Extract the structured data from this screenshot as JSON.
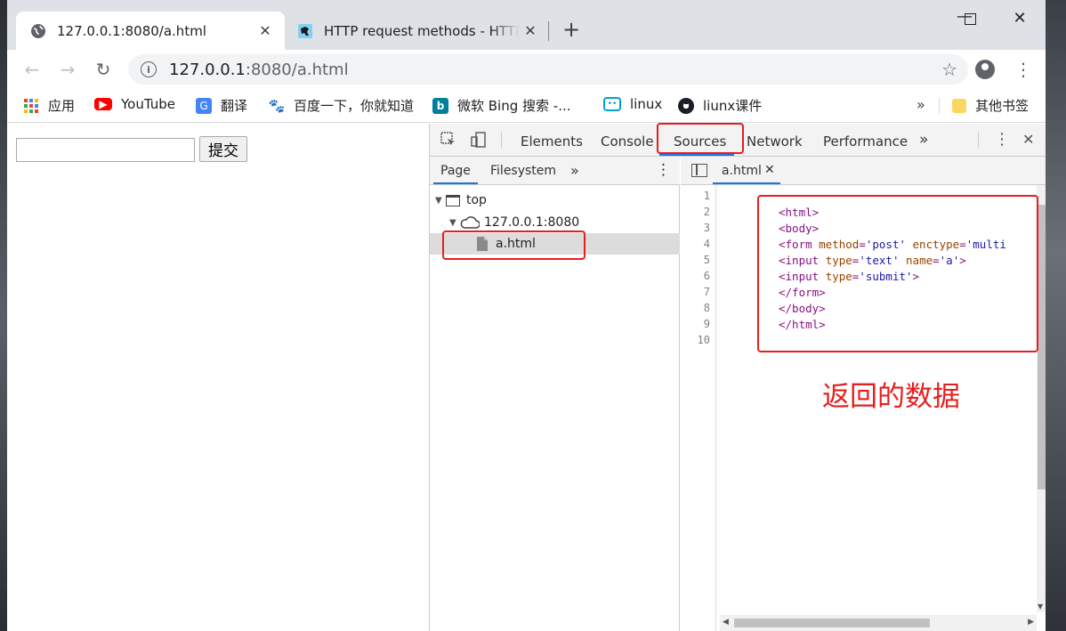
{
  "tabs": [
    {
      "title": "127.0.0.1:8080/a.html",
      "icon": "globe-icon"
    },
    {
      "title": "HTTP request methods - HTTP",
      "icon": "mdn-dino-icon"
    }
  ],
  "omnibox": {
    "host": "127.0.0.1",
    "rest": ":8080/a.html"
  },
  "bookmarks": [
    {
      "label": "应用",
      "icon": "apps-grid-icon"
    },
    {
      "label": "YouTube",
      "icon": "youtube-icon"
    },
    {
      "label": "翻译",
      "icon": "translate-icon"
    },
    {
      "label": "百度一下，你就知道",
      "icon": "baidu-paw-icon"
    },
    {
      "label": "微软 Bing 搜索 -...",
      "icon": "bing-icon"
    },
    {
      "label": "linux",
      "icon": "bilibili-tv-icon"
    },
    {
      "label": "liunx课件",
      "icon": "github-icon"
    }
  ],
  "bookmarks_more": "»",
  "bookmarks_other": "其他书签",
  "page": {
    "submit_label": "提交",
    "input_value": ""
  },
  "devtools": {
    "tabs": [
      "Elements",
      "Console",
      "Sources",
      "Network",
      "Performance"
    ],
    "more": "»",
    "nav_tabs": [
      "Page",
      "Filesystem"
    ],
    "tree": {
      "top": "top",
      "origin": "127.0.0.1:8080",
      "file": "a.html"
    },
    "editor_file": "a.html",
    "line_numbers": [
      "1",
      "2",
      "3",
      "4",
      "5",
      "6",
      "7",
      "8",
      "9",
      "10"
    ]
  },
  "code_lines": [
    {
      "parts": []
    },
    {
      "parts": [
        {
          "c": "tag",
          "t": "<html>"
        }
      ]
    },
    {
      "parts": [
        {
          "c": "tag",
          "t": "<body>"
        }
      ]
    },
    {
      "parts": [
        {
          "c": "tag",
          "t": "<form "
        },
        {
          "c": "attr",
          "t": "method"
        },
        {
          "c": "tag",
          "t": "="
        },
        {
          "c": "val",
          "t": "'post'"
        },
        {
          "c": "tag",
          "t": " "
        },
        {
          "c": "attr",
          "t": "enctype"
        },
        {
          "c": "tag",
          "t": "="
        },
        {
          "c": "val",
          "t": "'multi"
        }
      ]
    },
    {
      "parts": [
        {
          "c": "tag",
          "t": "<input "
        },
        {
          "c": "attr",
          "t": "type"
        },
        {
          "c": "tag",
          "t": "="
        },
        {
          "c": "val",
          "t": "'text'"
        },
        {
          "c": "tag",
          "t": " "
        },
        {
          "c": "attr",
          "t": "name"
        },
        {
          "c": "tag",
          "t": "="
        },
        {
          "c": "val",
          "t": "'a'"
        },
        {
          "c": "tag",
          "t": ">"
        }
      ]
    },
    {
      "parts": [
        {
          "c": "tag",
          "t": "<input "
        },
        {
          "c": "attr",
          "t": "type"
        },
        {
          "c": "tag",
          "t": "="
        },
        {
          "c": "val",
          "t": "'submit'"
        },
        {
          "c": "tag",
          "t": ">"
        }
      ]
    },
    {
      "parts": [
        {
          "c": "tag",
          "t": "</form>"
        }
      ]
    },
    {
      "parts": [
        {
          "c": "tag",
          "t": "</body>"
        }
      ]
    },
    {
      "parts": [
        {
          "c": "tag",
          "t": "</html>"
        }
      ]
    },
    {
      "parts": []
    }
  ],
  "annotation": "返回的数据",
  "colors": {
    "accent": "#1a73e8",
    "annotation_red": "#e61e1e"
  }
}
